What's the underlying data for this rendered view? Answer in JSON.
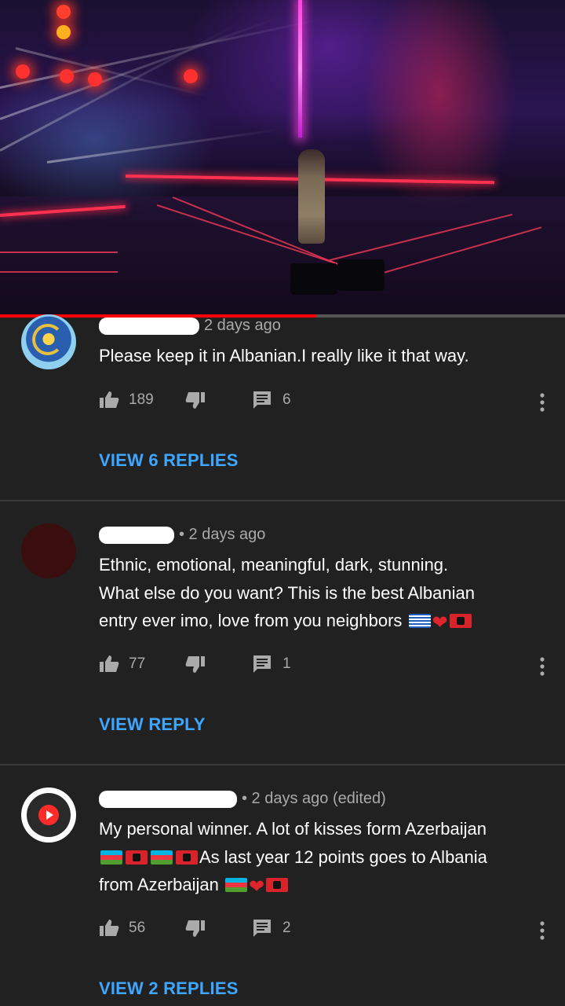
{
  "video": {
    "progress_fraction": 0.56
  },
  "comments": [
    {
      "time": "2 days ago",
      "text": "Please keep it in Albanian.I really like it that way.",
      "likes": "189",
      "reply_count": "6",
      "replies_label": "VIEW 6 REPLIES"
    },
    {
      "time": "• 2 days ago",
      "text_line1": "Ethnic, emotional, meaningful, dark, stunning.",
      "text_line2": "What else do you want? This is the best Albanian",
      "text_line3": "entry ever imo, love from you neighbors",
      "likes": "77",
      "reply_count": "1",
      "replies_label": "VIEW REPLY"
    },
    {
      "time": "• 2 days ago (edited)",
      "text_line1": "My personal winner. A lot of kisses form Azerbaijan",
      "text_line2": "As last year 12 points goes to Albania",
      "text_line3": "from Azerbaijan",
      "likes": "56",
      "reply_count": "2",
      "replies_label": "VIEW 2 REPLIES"
    }
  ],
  "icons": {
    "like": "thumbs-up-icon",
    "dislike": "thumbs-down-icon",
    "reply": "comment-icon",
    "more": "more-vertical-icon"
  },
  "colors": {
    "link": "#3ea6ff",
    "progress": "#ff0000",
    "background": "#212121",
    "meta": "#aaaaaa"
  }
}
